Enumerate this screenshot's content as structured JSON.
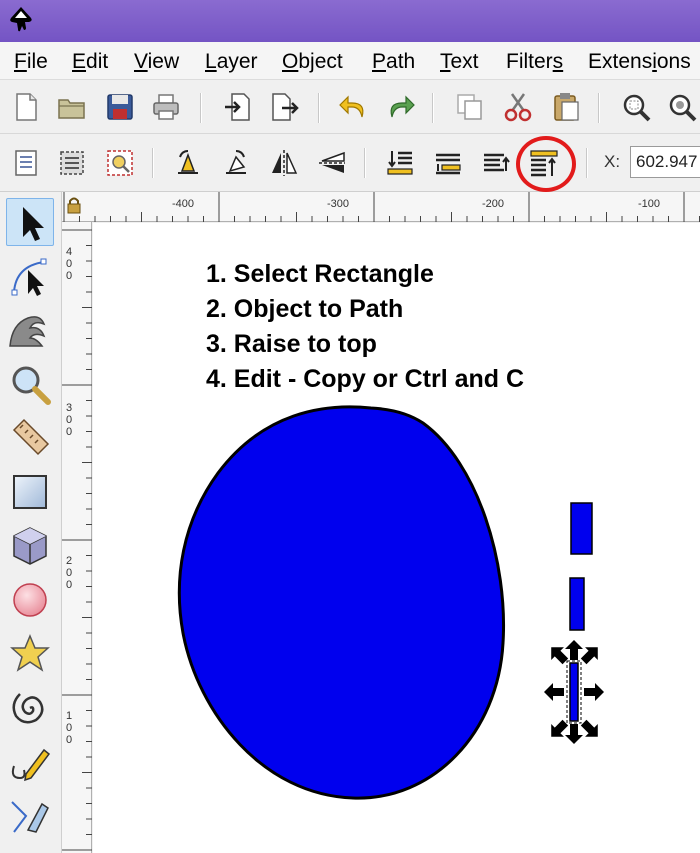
{
  "window": {
    "app_icon": "inkscape-icon"
  },
  "menu": [
    {
      "label": "File",
      "accel_index": 0
    },
    {
      "label": "Edit",
      "accel_index": 0
    },
    {
      "label": "View",
      "accel_index": 0
    },
    {
      "label": "Layer",
      "accel_index": 0
    },
    {
      "label": "Object",
      "accel_index": 0
    },
    {
      "label": "Path",
      "accel_index": 0
    },
    {
      "label": "Text",
      "accel_index": 0
    },
    {
      "label": "Filters",
      "accel_index": 6
    },
    {
      "label": "Extensions",
      "accel_index": 6
    }
  ],
  "toolbar_commands": [
    "new-document-icon",
    "open-folder-icon",
    "save-icon",
    "print-icon",
    "import-icon",
    "export-icon",
    "undo-icon",
    "redo-icon",
    "duplicate-icon",
    "cut-icon",
    "paste-icon",
    "zoom-selection-icon",
    "zoom-drawing-icon"
  ],
  "toolbar_select": [
    "select-all-icon",
    "select-all-layers-icon",
    "deselect-icon",
    "rotate-ccw-icon",
    "rotate-cw-icon",
    "flip-horizontal-icon",
    "flip-vertical-icon",
    "lower-to-bottom-icon",
    "lower-icon",
    "raise-icon",
    "raise-to-top-icon"
  ],
  "coordinates": {
    "x_label": "X:",
    "x_value": "602.947"
  },
  "highlight_color": "#e21b1b",
  "tools": [
    "selector-tool-icon",
    "node-tool-icon",
    "tweak-tool-icon",
    "zoom-tool-icon",
    "measure-tool-icon",
    "rectangle-tool-icon",
    "3d-box-tool-icon",
    "ellipse-tool-icon",
    "star-tool-icon",
    "spiral-tool-icon",
    "pencil-tool-icon",
    "pen-tool-icon"
  ],
  "rulers": {
    "horizontal": [
      "-400",
      "-300",
      "-200",
      "-100"
    ],
    "vertical": [
      "4\n0\n0",
      "3\n0\n0",
      "2\n0\n0",
      "1\n0\n0"
    ]
  },
  "canvas": {
    "instructions": [
      "1. Select Rectangle",
      "2. Object to Path",
      "3. Raise to top",
      "4. Edit - Copy or Ctrl and C"
    ],
    "shape_fill": "#0000ee",
    "shape_stroke": "#000000"
  }
}
